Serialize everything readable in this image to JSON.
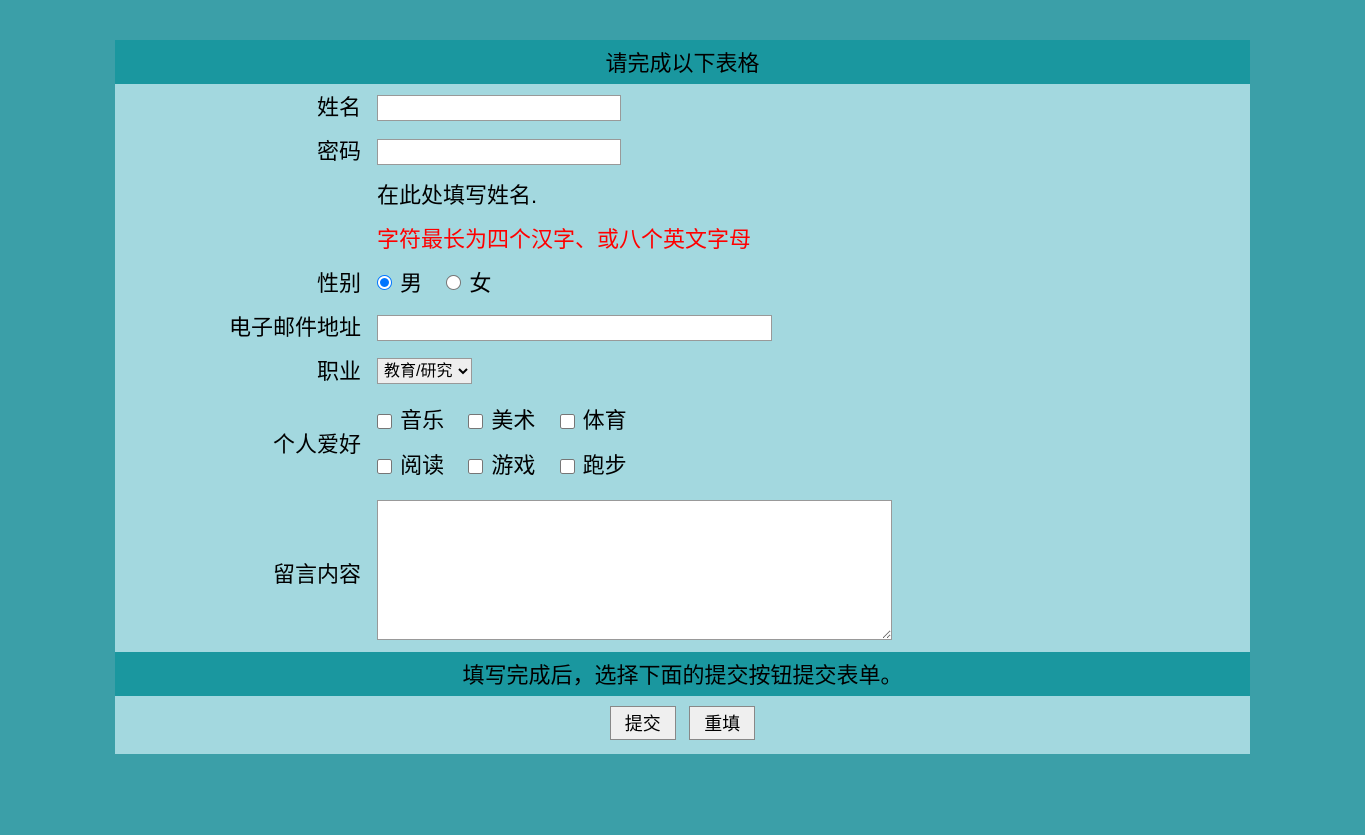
{
  "header": {
    "title": "请完成以下表格"
  },
  "labels": {
    "name": "姓名",
    "password": "密码",
    "hint1": "在此处填写姓名.",
    "hint2": "字符最长为四个汉字、或八个英文字母",
    "gender": "性别",
    "email": "电子邮件地址",
    "occupation": "职业",
    "hobby": "个人爱好",
    "message": "留言内容"
  },
  "gender": {
    "male": "男",
    "female": "女",
    "selected": "male"
  },
  "occupation_selected": "教育/研究",
  "hobbies": {
    "music": "音乐",
    "art": "美术",
    "sports": "体育",
    "reading": "阅读",
    "game": "游戏",
    "running": "跑步"
  },
  "footer": {
    "hint": "填写完成后，选择下面的提交按钮提交表单。"
  },
  "buttons": {
    "submit": "提交",
    "reset": "重填"
  }
}
